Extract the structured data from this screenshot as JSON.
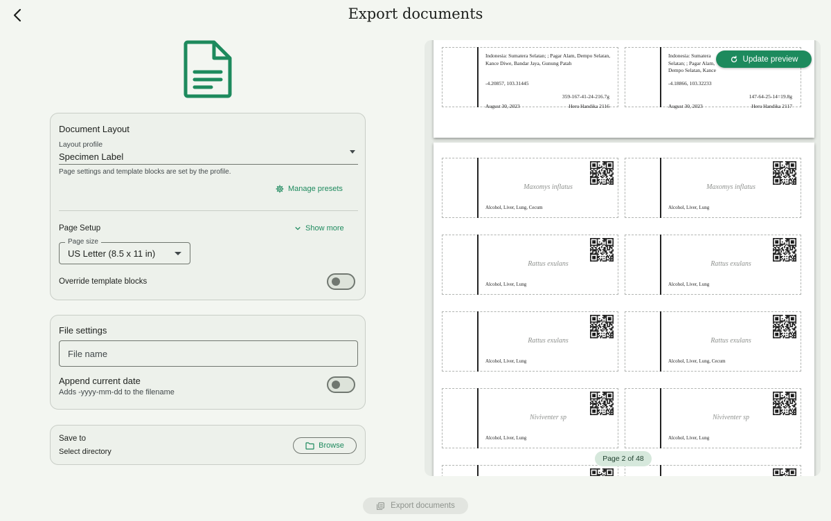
{
  "header": {
    "title": "Export documents",
    "back_icon": "chevron-left-icon"
  },
  "document_layout": {
    "title": "Document Layout",
    "profile_label": "Layout profile",
    "profile_value": "Specimen Label",
    "profile_helper": "Page settings and template blocks are set by the profile.",
    "manage_presets": "Manage presets",
    "page_setup": "Page Setup",
    "show_more": "Show more",
    "page_size_label": "Page size",
    "page_size_value": "US Letter (8.5 x 11 in)",
    "override_label": "Override template blocks",
    "override_on": false
  },
  "file_settings": {
    "title": "File settings",
    "file_name_placeholder": "File name",
    "append_date_label": "Append current date",
    "append_date_helper": "Adds -yyyy-mm-dd to the filename",
    "append_date_on": false
  },
  "save": {
    "title": "Save to",
    "subtitle": "Select directory",
    "browse": "Browse"
  },
  "preview": {
    "update_button": "Update preview",
    "page_indicator": "Page 2 of 48",
    "page1_labels": [
      {
        "location": "Indonesia: Sumatera Selatan; ; Pagar Alam, Dempo Selatan, Kance Diwe, Bandar Jaya, Gunung Patah",
        "coords": "-4.20857, 103.31445",
        "catalog": "359-167-41-24-216.7g",
        "date": "August 30, 2023",
        "collector": "Heru Handika 2116"
      },
      {
        "location": "Indonesia: Sumatera Selatan; ; Pagar Alam, Dempo Selatan, Kance Diwe, Bandar Jaya, Gunung Patah",
        "coords": "-4.18866, 103.32233",
        "catalog": "147-64-25-14=19.8g",
        "date": "August 30, 2023",
        "collector": "Heru Handika 2117"
      }
    ],
    "page2_labels": [
      {
        "species": "Maxomys inflatus",
        "tissue": "Alcohol, Liver, Lung, Cecum"
      },
      {
        "species": "Maxomys inflatus",
        "tissue": "Alcohol, Liver, Lung"
      },
      {
        "species": "Rattus exulans",
        "tissue": "Alcohol, Liver, Lung"
      },
      {
        "species": "Rattus exulans",
        "tissue": "Alcohol, Liver, Lung"
      },
      {
        "species": "Rattus exulans",
        "tissue": "Alcohol, Liver, Lung"
      },
      {
        "species": "Rattus exulans",
        "tissue": "Alcohol, Liver, Lung, Cecum"
      },
      {
        "species": "Niviventer sp",
        "tissue": "Alcohol, Liver, Lung"
      },
      {
        "species": "Niviventer sp",
        "tissue": "Alcohol, Liver, Lung"
      }
    ]
  },
  "footer": {
    "export_button": "Export documents"
  },
  "colors": {
    "accent": "#1d8a5d",
    "background": "#f3f6f1",
    "card": "#edf1eb"
  }
}
